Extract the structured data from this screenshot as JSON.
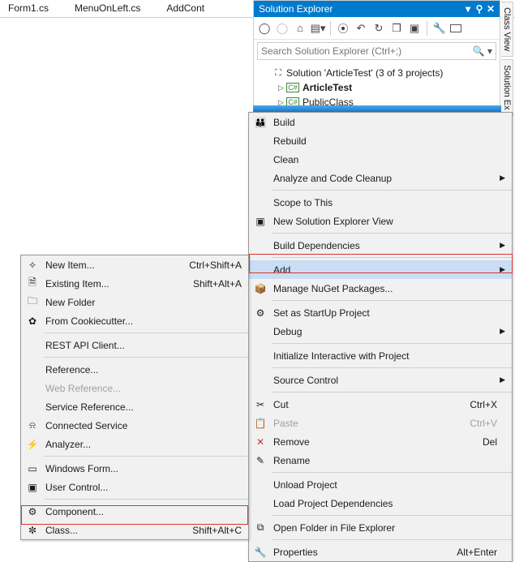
{
  "tabs": {
    "t0": "Form1.cs",
    "t1": "MenuOnLeft.cs",
    "t2": "AddCont"
  },
  "solExplorer": {
    "title": "Solution Explorer",
    "searchPlaceholder": "Search Solution Explorer (Ctrl+;)",
    "solutionLine": "Solution 'ArticleTest' (3 of 3 projects)",
    "proj0": "ArticleTest",
    "proj1": "PublicClass"
  },
  "sideTabs": {
    "t0": "Class View",
    "t1": "Solution Ex"
  },
  "mainMenu": {
    "build": "Build",
    "rebuild": "Rebuild",
    "clean": "Clean",
    "analyze": "Analyze and Code Cleanup",
    "scope": "Scope to This",
    "newSol": "New Solution Explorer View",
    "buildDeps": "Build Dependencies",
    "add": "Add",
    "nuget": "Manage NuGet Packages...",
    "startup": "Set as StartUp Project",
    "debug": "Debug",
    "init": "Initialize Interactive with Project",
    "sourceCtrl": "Source Control",
    "cut": "Cut",
    "paste": "Paste",
    "remove": "Remove",
    "rename": "Rename",
    "unload": "Unload Project",
    "loadDeps": "Load Project Dependencies",
    "openFolder": "Open Folder in File Explorer",
    "props": "Properties",
    "sc_cut": "Ctrl+X",
    "sc_paste": "Ctrl+V",
    "sc_remove": "Del",
    "sc_props": "Alt+Enter"
  },
  "addMenu": {
    "newItem": "New Item...",
    "sc_newItem": "Ctrl+Shift+A",
    "existing": "Existing Item...",
    "sc_existing": "Shift+Alt+A",
    "newFolder": "New Folder",
    "cookie": "From Cookiecutter...",
    "rest": "REST API Client...",
    "reference": "Reference...",
    "webRef": "Web Reference...",
    "svcRef": "Service Reference...",
    "connSvc": "Connected Service",
    "analyzer": "Analyzer...",
    "winForm": "Windows Form...",
    "userCtl": "User Control...",
    "component": "Component...",
    "class": "Class...",
    "sc_class": "Shift+Alt+C"
  }
}
